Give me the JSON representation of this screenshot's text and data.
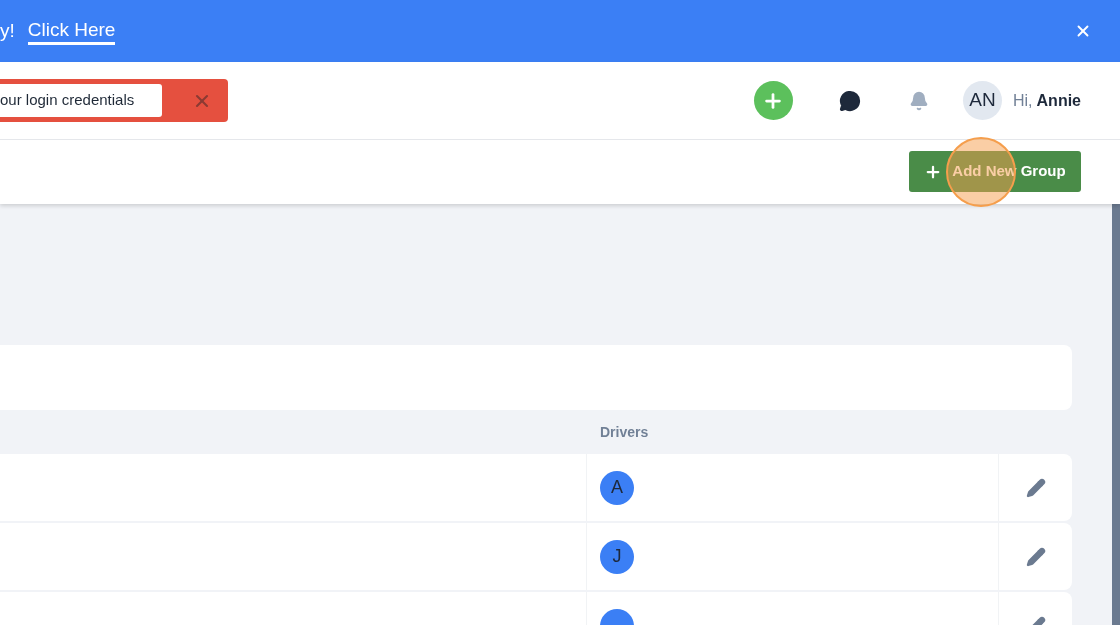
{
  "banner": {
    "text": "y!",
    "link": "Click Here"
  },
  "alert": {
    "message": "our login credentials"
  },
  "user": {
    "initials": "AN",
    "greeting": "Hi,",
    "name": "Annie"
  },
  "toolbar": {
    "add_button": "Add New Group"
  },
  "table": {
    "columns": [
      "Drivers"
    ],
    "rows": [
      {
        "driver_initial": "A"
      },
      {
        "driver_initial": "J"
      },
      {}
    ]
  }
}
